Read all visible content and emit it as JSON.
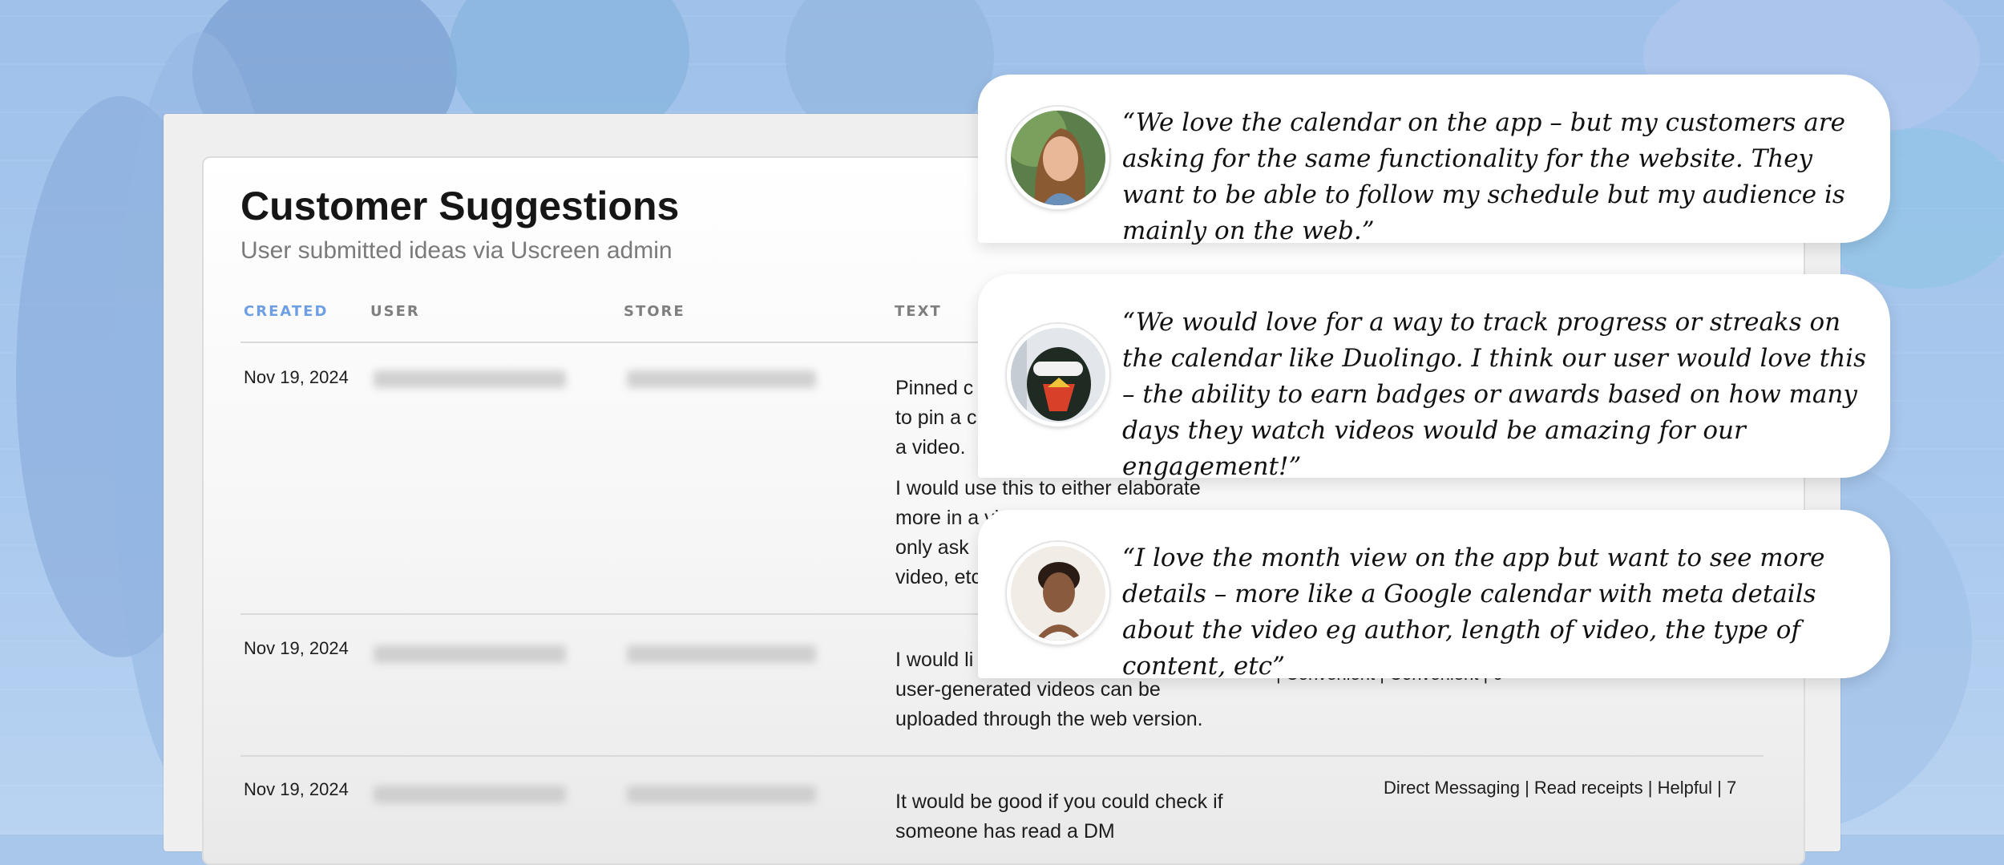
{
  "page": {
    "title": "Customer Suggestions",
    "subtitle": "User submitted ideas via Uscreen admin"
  },
  "table": {
    "headers": [
      "CREATED",
      "USER",
      "STORE",
      "TEXT"
    ],
    "rows": [
      {
        "created": "Nov 19, 2024",
        "text_visible": [
          "Pinned c",
          "to pin a c",
          "a video.",
          "I would use this to either elaborate",
          "more in a vi",
          "only ask",
          "video, etc"
        ],
        "tags": ""
      },
      {
        "created": "Nov 19, 2024",
        "text_visible": [
          "I would li",
          "user-generated videos can be",
          "uploaded through the web version."
        ],
        "tags": "| Convenient | Convenient | 6"
      },
      {
        "created": "Nov 19, 2024",
        "text_visible": [
          "It would be good if you could check if",
          "someone has read a DM"
        ],
        "tags": "Direct Messaging | Read receipts | Helpful | 7"
      }
    ]
  },
  "testimonials": [
    {
      "quote": "“We love the calendar on the app – but my customers are asking for the same functionality for the website. They want to be able to follow my schedule but my audience is mainly on the web.”",
      "avatar": "woman-long-hair-avatar"
    },
    {
      "quote": "“We would love for a way to track progress or streaks on the calendar like Duolingo. I think our user would love this – the ability to earn badges or awards based on how many days they watch videos would be amazing for our engagement!”",
      "avatar": "skier-goggles-avatar"
    },
    {
      "quote": "“I love the month view on the app but want to see more details – more like a Google calendar with meta details about the video eg author, length of video, the type of content, etc”",
      "avatar": "woman-smiling-avatar"
    }
  ],
  "colors": {
    "background": "#a9c7ea",
    "active_header": "#6e9fe3",
    "header": "#7f7f7f"
  }
}
